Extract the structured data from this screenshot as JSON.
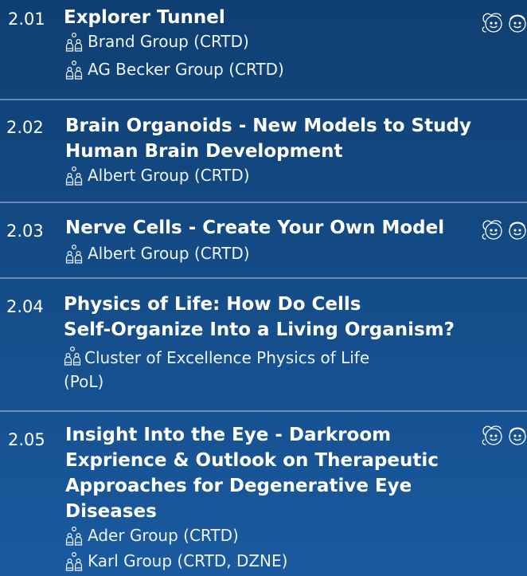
{
  "entries": [
    {
      "number": "2.01",
      "title_lines": [
        "Explorer Tunnel"
      ],
      "groups": [
        [
          "Brand Group (CRTD)"
        ],
        [
          "AG Becker Group (CRTD)"
        ]
      ],
      "kids_icon": "girl-boy-faces-icon"
    },
    {
      "number": "2.02",
      "title_lines": [
        "Brain Organoids - New Models to Study",
        "Human Brain Development"
      ],
      "groups": [
        [
          "Albert Group (CRTD)"
        ]
      ],
      "kids_icon": null
    },
    {
      "number": "2.03",
      "title_lines": [
        "Nerve Cells - Create Your Own Model"
      ],
      "groups": [
        [
          "Albert Group (CRTD)"
        ]
      ],
      "kids_icon": "girl-boy-faces-icon"
    },
    {
      "number": "2.04",
      "title_lines": [
        "Physics of Life: How Do Cells",
        "Self-Organize Into a Living Organism?"
      ],
      "groups": [
        [
          "Cluster of Excellence Physics of Life",
          "(PoL)"
        ]
      ],
      "kids_icon": null
    },
    {
      "number": "2.05",
      "title_lines": [
        "Insight Into the Eye - Darkroom",
        "Exprience & Outlook on Therapeutic",
        "Approaches for Degenerative Eye",
        "Diseases"
      ],
      "groups": [
        [
          "Ader Group (CRTD)"
        ],
        [
          "Karl Group (CRTD, DZNE)"
        ]
      ],
      "kids_icon": "girl-boy-faces-icon"
    }
  ],
  "icons": {
    "group": "people-group-icon"
  },
  "colors": {
    "background_top": "#0f3f72",
    "background_bottom": "#1a5a9f",
    "divider": "#7d9cc0",
    "text": "#ffffff"
  }
}
